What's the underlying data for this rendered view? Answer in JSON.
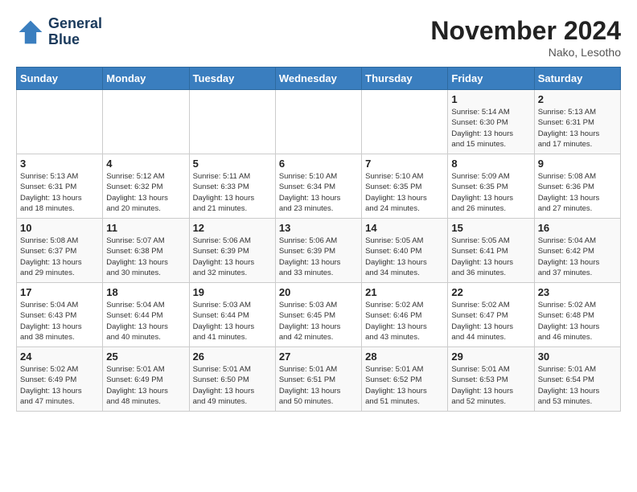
{
  "header": {
    "logo_line1": "General",
    "logo_line2": "Blue",
    "month": "November 2024",
    "location": "Nako, Lesotho"
  },
  "weekdays": [
    "Sunday",
    "Monday",
    "Tuesday",
    "Wednesday",
    "Thursday",
    "Friday",
    "Saturday"
  ],
  "weeks": [
    [
      {
        "day": "",
        "info": ""
      },
      {
        "day": "",
        "info": ""
      },
      {
        "day": "",
        "info": ""
      },
      {
        "day": "",
        "info": ""
      },
      {
        "day": "",
        "info": ""
      },
      {
        "day": "1",
        "info": "Sunrise: 5:14 AM\nSunset: 6:30 PM\nDaylight: 13 hours\nand 15 minutes."
      },
      {
        "day": "2",
        "info": "Sunrise: 5:13 AM\nSunset: 6:31 PM\nDaylight: 13 hours\nand 17 minutes."
      }
    ],
    [
      {
        "day": "3",
        "info": "Sunrise: 5:13 AM\nSunset: 6:31 PM\nDaylight: 13 hours\nand 18 minutes."
      },
      {
        "day": "4",
        "info": "Sunrise: 5:12 AM\nSunset: 6:32 PM\nDaylight: 13 hours\nand 20 minutes."
      },
      {
        "day": "5",
        "info": "Sunrise: 5:11 AM\nSunset: 6:33 PM\nDaylight: 13 hours\nand 21 minutes."
      },
      {
        "day": "6",
        "info": "Sunrise: 5:10 AM\nSunset: 6:34 PM\nDaylight: 13 hours\nand 23 minutes."
      },
      {
        "day": "7",
        "info": "Sunrise: 5:10 AM\nSunset: 6:35 PM\nDaylight: 13 hours\nand 24 minutes."
      },
      {
        "day": "8",
        "info": "Sunrise: 5:09 AM\nSunset: 6:35 PM\nDaylight: 13 hours\nand 26 minutes."
      },
      {
        "day": "9",
        "info": "Sunrise: 5:08 AM\nSunset: 6:36 PM\nDaylight: 13 hours\nand 27 minutes."
      }
    ],
    [
      {
        "day": "10",
        "info": "Sunrise: 5:08 AM\nSunset: 6:37 PM\nDaylight: 13 hours\nand 29 minutes."
      },
      {
        "day": "11",
        "info": "Sunrise: 5:07 AM\nSunset: 6:38 PM\nDaylight: 13 hours\nand 30 minutes."
      },
      {
        "day": "12",
        "info": "Sunrise: 5:06 AM\nSunset: 6:39 PM\nDaylight: 13 hours\nand 32 minutes."
      },
      {
        "day": "13",
        "info": "Sunrise: 5:06 AM\nSunset: 6:39 PM\nDaylight: 13 hours\nand 33 minutes."
      },
      {
        "day": "14",
        "info": "Sunrise: 5:05 AM\nSunset: 6:40 PM\nDaylight: 13 hours\nand 34 minutes."
      },
      {
        "day": "15",
        "info": "Sunrise: 5:05 AM\nSunset: 6:41 PM\nDaylight: 13 hours\nand 36 minutes."
      },
      {
        "day": "16",
        "info": "Sunrise: 5:04 AM\nSunset: 6:42 PM\nDaylight: 13 hours\nand 37 minutes."
      }
    ],
    [
      {
        "day": "17",
        "info": "Sunrise: 5:04 AM\nSunset: 6:43 PM\nDaylight: 13 hours\nand 38 minutes."
      },
      {
        "day": "18",
        "info": "Sunrise: 5:04 AM\nSunset: 6:44 PM\nDaylight: 13 hours\nand 40 minutes."
      },
      {
        "day": "19",
        "info": "Sunrise: 5:03 AM\nSunset: 6:44 PM\nDaylight: 13 hours\nand 41 minutes."
      },
      {
        "day": "20",
        "info": "Sunrise: 5:03 AM\nSunset: 6:45 PM\nDaylight: 13 hours\nand 42 minutes."
      },
      {
        "day": "21",
        "info": "Sunrise: 5:02 AM\nSunset: 6:46 PM\nDaylight: 13 hours\nand 43 minutes."
      },
      {
        "day": "22",
        "info": "Sunrise: 5:02 AM\nSunset: 6:47 PM\nDaylight: 13 hours\nand 44 minutes."
      },
      {
        "day": "23",
        "info": "Sunrise: 5:02 AM\nSunset: 6:48 PM\nDaylight: 13 hours\nand 46 minutes."
      }
    ],
    [
      {
        "day": "24",
        "info": "Sunrise: 5:02 AM\nSunset: 6:49 PM\nDaylight: 13 hours\nand 47 minutes."
      },
      {
        "day": "25",
        "info": "Sunrise: 5:01 AM\nSunset: 6:49 PM\nDaylight: 13 hours\nand 48 minutes."
      },
      {
        "day": "26",
        "info": "Sunrise: 5:01 AM\nSunset: 6:50 PM\nDaylight: 13 hours\nand 49 minutes."
      },
      {
        "day": "27",
        "info": "Sunrise: 5:01 AM\nSunset: 6:51 PM\nDaylight: 13 hours\nand 50 minutes."
      },
      {
        "day": "28",
        "info": "Sunrise: 5:01 AM\nSunset: 6:52 PM\nDaylight: 13 hours\nand 51 minutes."
      },
      {
        "day": "29",
        "info": "Sunrise: 5:01 AM\nSunset: 6:53 PM\nDaylight: 13 hours\nand 52 minutes."
      },
      {
        "day": "30",
        "info": "Sunrise: 5:01 AM\nSunset: 6:54 PM\nDaylight: 13 hours\nand 53 minutes."
      }
    ]
  ]
}
